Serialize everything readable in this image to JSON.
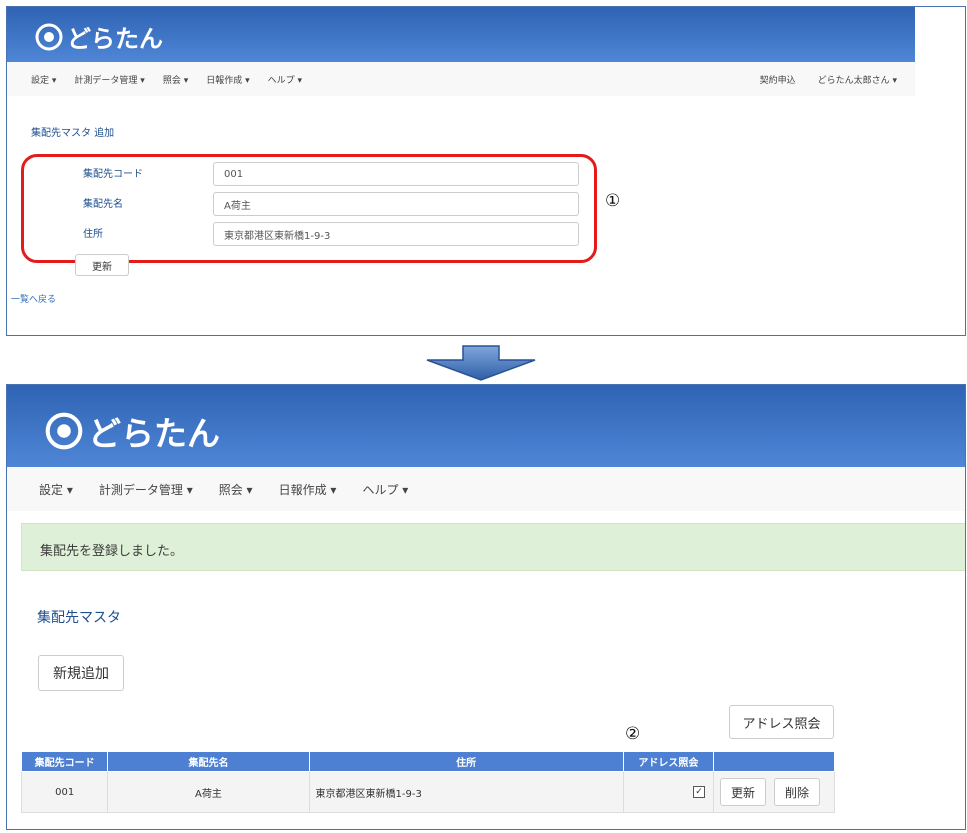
{
  "app": {
    "logo_text": "どらたん"
  },
  "nav": {
    "menus": [
      {
        "label": "設定"
      },
      {
        "label": "計測データ管理"
      },
      {
        "label": "照会"
      },
      {
        "label": "日報作成"
      },
      {
        "label": "ヘルプ"
      }
    ],
    "contract_link": "契約申込",
    "user_menu": "どらたん太郎さん"
  },
  "form": {
    "page_title": "集配先マスタ 追加",
    "fields": [
      {
        "label": "集配先コード",
        "value": "001"
      },
      {
        "label": "集配先名",
        "value": "A荷主"
      },
      {
        "label": "住所",
        "value": "東京都港区東新橋1-9-3"
      }
    ],
    "submit_label": "更新",
    "back_link": "一覧へ戻る",
    "callout": "①"
  },
  "list": {
    "alert": "集配先を登録しました。",
    "page_title": "集配先マスタ",
    "add_button": "新規追加",
    "address_button": "アドレス照会",
    "callout": "②",
    "columns": [
      "集配先コード",
      "集配先名",
      "住所",
      "アドレス照会",
      ""
    ],
    "rows": [
      {
        "code": "001",
        "name": "A荷主",
        "address": "東京都港区東新橋1-9-3",
        "address_check": true,
        "update_label": "更新",
        "delete_label": "削除"
      }
    ]
  },
  "colors": {
    "header_blue": "#3a70c4",
    "highlight_red": "#e31b1b",
    "alert_green": "#dff0d8",
    "table_header": "#4d80d2"
  }
}
